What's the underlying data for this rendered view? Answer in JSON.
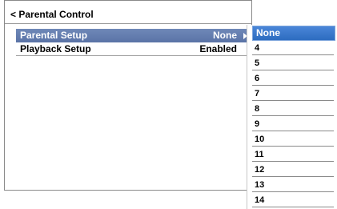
{
  "header": {
    "title": "< Parental Control"
  },
  "menu": {
    "items": [
      {
        "label": "Parental Setup",
        "value": "None"
      },
      {
        "label": "Playback Setup",
        "value": "Enabled"
      }
    ]
  },
  "dropdown": {
    "options": [
      "None",
      "4",
      "5",
      "6",
      "7",
      "8",
      "9",
      "10",
      "11",
      "12",
      "13",
      "14"
    ]
  },
  "colors": {
    "selected_row": "#5f79ab",
    "selected_option": "#3a78cc"
  }
}
